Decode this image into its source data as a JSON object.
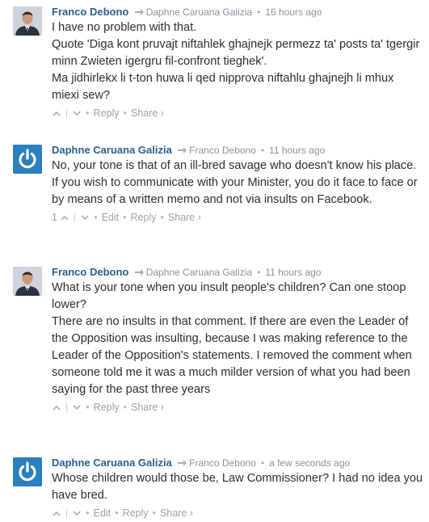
{
  "comments": [
    {
      "author": "Franco Debono",
      "reply_to": "Daphne Caruana Galizia",
      "time": "16 hours ago",
      "paragraphs": [
        "I have no problem with that.",
        "Quote 'Diga kont pruvajt niftahlek ghajnejk permezz ta' posts ta' tgergir minn Zwieten igergru fil-confront tieghek'.",
        "Ma jidhirlekx li t-ton huwa li qed nipprova niftahlu ghajnejh li mhux miexi sew?"
      ],
      "vote_count": "",
      "actions": [
        "Reply",
        "Share ›"
      ]
    },
    {
      "author": "Daphne Caruana Galizia",
      "reply_to": "Franco Debono",
      "time": "11 hours ago",
      "paragraphs": [
        "No, your tone is that of an ill-bred savage who doesn't know his place. If you wish to communicate with your Minister, you do it face to face or by means of a written memo and not via insults on Facebook."
      ],
      "vote_count": "1",
      "actions": [
        "Edit",
        "Reply",
        "Share ›"
      ]
    },
    {
      "author": "Franco Debono",
      "reply_to": "Daphne Caruana Galizia",
      "time": "11 hours ago",
      "paragraphs": [
        "What is your tone when you insult people's children? Can one stoop lower?",
        "There are no insults in that comment. If there are even the Leader of the Opposition was insulting, because I was making reference to the Leader of the Opposition's statements. I removed the comment when someone told me it was a much milder version of what you had been saying for the past three years"
      ],
      "vote_count": "",
      "actions": [
        "Reply",
        "Share ›"
      ]
    },
    {
      "author": "Daphne Caruana Galizia",
      "reply_to": "Franco Debono",
      "time": "a few seconds ago",
      "paragraphs": [
        "Whose children would those be, Law Commissioner? I had no idea you have bred."
      ],
      "vote_count": "",
      "actions": [
        "Edit",
        "Reply",
        "Share ›"
      ]
    }
  ],
  "icons": {
    "upvote": "chevron-up-icon",
    "downvote": "chevron-down-icon",
    "reply_to": "reply-arrow-icon",
    "avatar_photo": "user-photo-icon",
    "avatar_logo": "power-logo-icon"
  },
  "colors": {
    "author": "#2a5f8f",
    "meta": "#8a9299",
    "logo_bg": "#2a7fbf",
    "text": "#2e2e2e"
  }
}
